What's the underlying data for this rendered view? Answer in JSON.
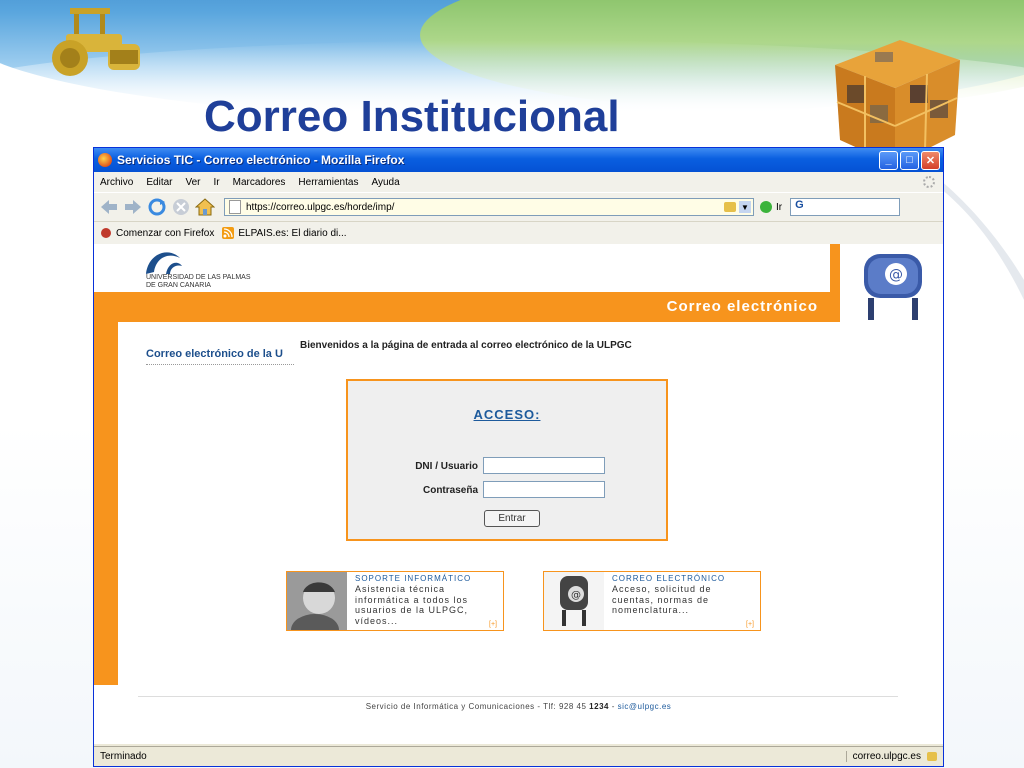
{
  "slide": {
    "title": "Correo Institucional"
  },
  "window": {
    "title": "Servicios TIC - Correo electrónico - Mozilla Firefox"
  },
  "menu": [
    "Archivo",
    "Editar",
    "Ver",
    "Ir",
    "Marcadores",
    "Herramientas",
    "Ayuda"
  ],
  "nav": {
    "url": "https://correo.ulpgc.es/horde/imp/",
    "go_label": "Ir",
    "search_value": "G"
  },
  "bookmarks": [
    "Comenzar con Firefox",
    "ELPAIS.es: El diario di..."
  ],
  "page": {
    "university": [
      "UNIVERSIDAD DE LAS PALMAS",
      "DE GRAN CANARIA"
    ],
    "banner_label": "Correo electrónico",
    "side_title": "Correo electrónico de la U",
    "welcome": "Bienvenidos a la página de entrada al correo electrónico de la ULPGC",
    "login": {
      "heading": "ACCESO:",
      "user_label": "DNI / Usuario",
      "password_label": "Contraseña",
      "submit_label": "Entrar"
    },
    "cards": [
      {
        "title": "SOPORTE INFORMÁTICO",
        "desc": "Asistencia técnica informática a todos los usuarios de la ULPGC, vídeos...",
        "more": "[+]"
      },
      {
        "title": "CORREO ELECTRÓNICO",
        "desc": "Acceso, solicitud de cuentas, normas de nomenclatura...",
        "more": "[+]"
      }
    ],
    "footer": {
      "text": "Servicio de Informática y Comunicaciones - Tlf: 928 45 ",
      "ext": "1234",
      "sep": " - ",
      "email": "sic@ulpgc.es"
    }
  },
  "status": {
    "left": "Terminado",
    "right": "correo.ulpgc.es"
  },
  "colors": {
    "accent": "#f7941d",
    "title": "#1f3f99",
    "link": "#1d5a9c"
  }
}
